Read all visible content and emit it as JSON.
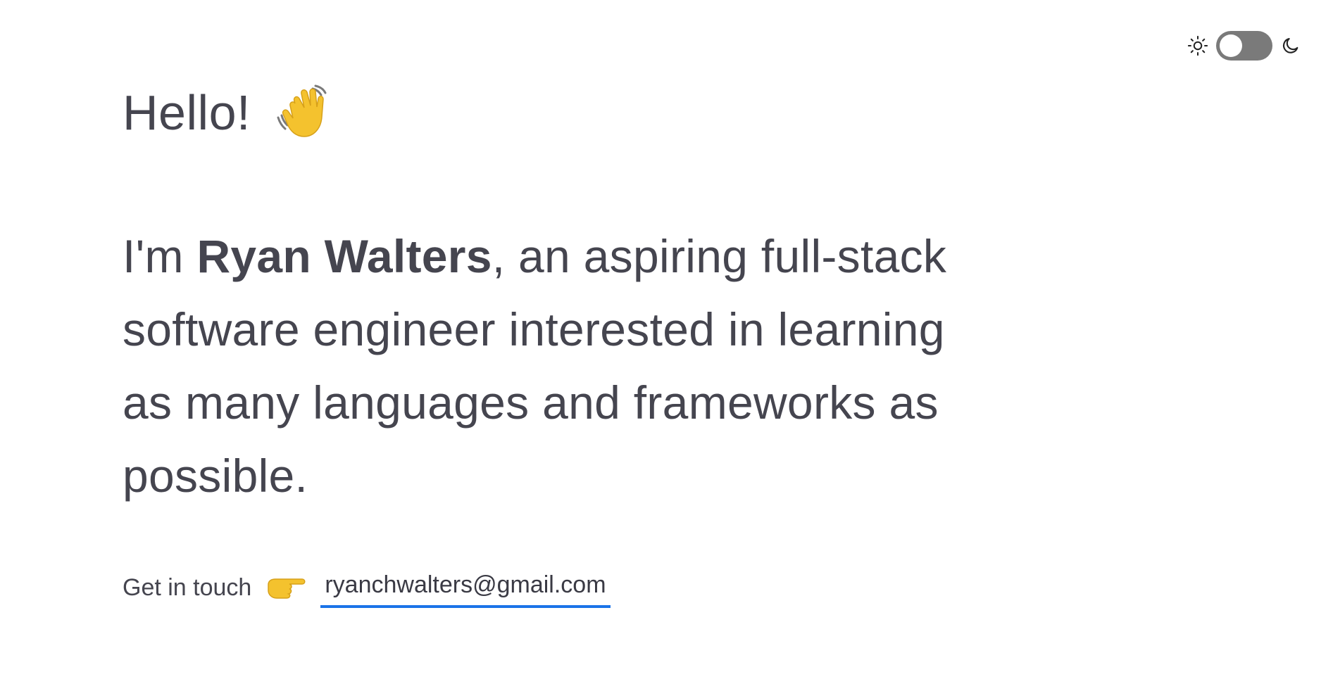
{
  "theme_toggle": {
    "light_icon": "sun-icon",
    "dark_icon": "moon-icon",
    "state": "light"
  },
  "greeting": {
    "text": "Hello!",
    "emoji_icon": "waving-hand-icon"
  },
  "intro": {
    "prefix": "I'm ",
    "name": "Ryan Walters",
    "suffix": ", an aspiring full-stack software engineer interested in learning as many languages and frameworks as possible."
  },
  "contact": {
    "label": "Get in touch",
    "pointer_icon": "pointing-right-icon",
    "email": "ryanchwalters@gmail.com"
  },
  "colors": {
    "text": "#45454f",
    "link_underline": "#1a73e8",
    "toggle_track": "#7a7a7a"
  }
}
